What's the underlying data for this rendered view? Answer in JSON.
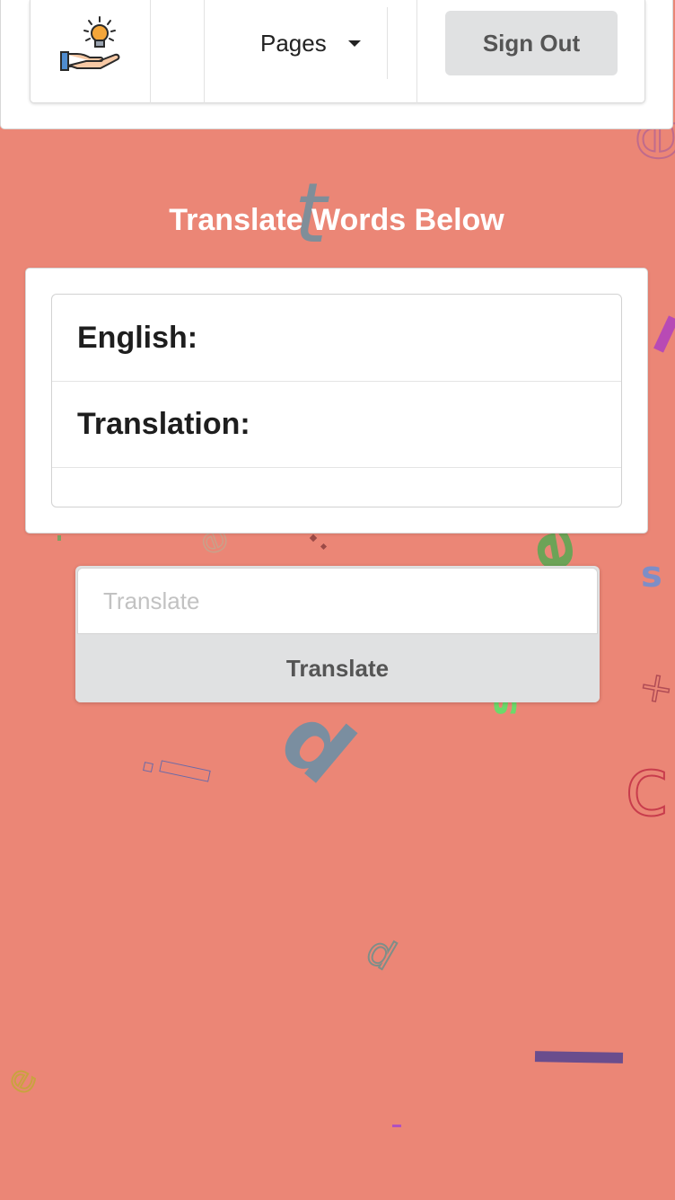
{
  "nav": {
    "pages_label": "Pages",
    "sign_out_label": "Sign Out"
  },
  "main": {
    "title": "Translate Words Below",
    "table": {
      "rows": [
        {
          "label": "English:"
        },
        {
          "label": "Translation:"
        },
        {
          "label": ""
        }
      ]
    },
    "input": {
      "placeholder": "Translate",
      "value": ""
    },
    "button_label": "Translate"
  },
  "decorations": {
    "letters": [
      "t",
      "e",
      "s",
      "p",
      "+",
      "c",
      "e",
      "e",
      "s",
      "d",
      "e"
    ]
  },
  "colors": {
    "background": "#eb8676",
    "button_gray": "#e0e1e2",
    "title_white": "#ffffff"
  }
}
